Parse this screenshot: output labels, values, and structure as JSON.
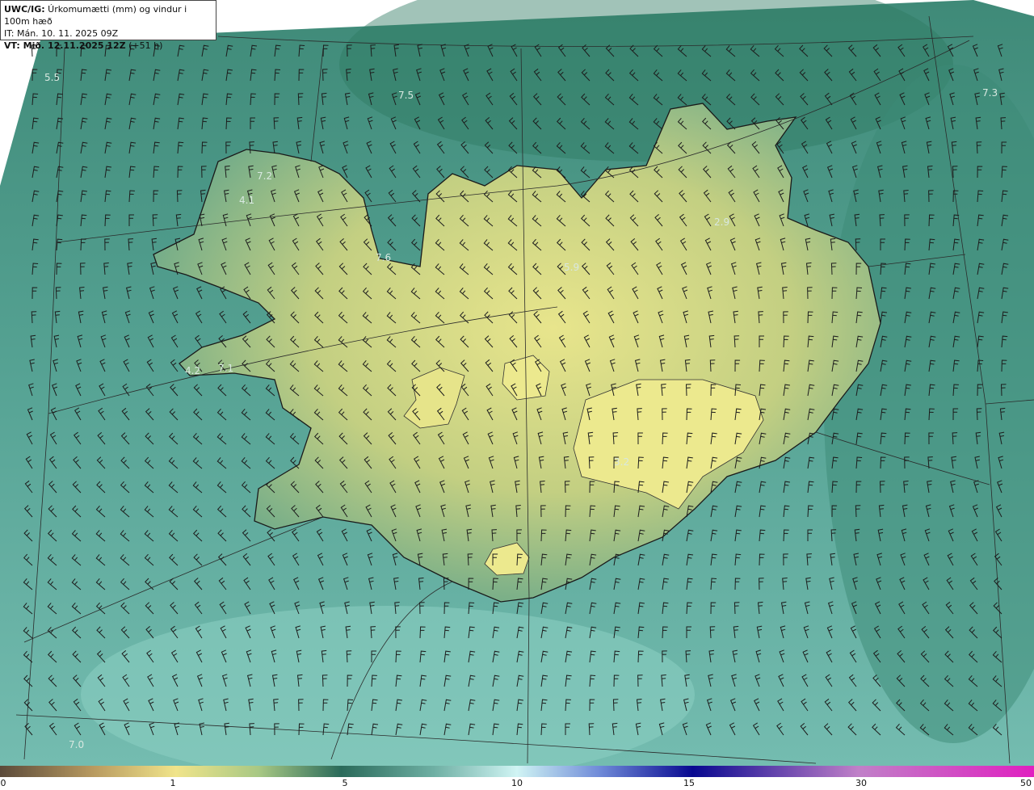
{
  "header": {
    "model": "UWC/IG:",
    "title": " Úrkomumætti (mm) og vindur i 100m hæð",
    "issue_time": "IT: Mán. 10. 11. 2025 09Z",
    "valid_prefix": "VT: ",
    "valid_time": "Mið. 12.11.2025 12Z",
    "lead": " (+51 h)"
  },
  "map": {
    "value_labels": [
      {
        "text": "5.5"
      },
      {
        "text": "7.5"
      },
      {
        "text": "7.3"
      },
      {
        "text": "7.2"
      },
      {
        "text": "4.1"
      },
      {
        "text": "2.9"
      },
      {
        "text": "7.6"
      },
      {
        "text": "5.9"
      },
      {
        "text": "4.2"
      },
      {
        "text": "7.1"
      },
      {
        "text": "3.2"
      },
      {
        "text": "7.0"
      }
    ]
  },
  "colorbar": {
    "ticks": [
      "0",
      "1",
      "5",
      "10",
      "15",
      "30",
      "50"
    ],
    "colors": [
      "#5b4a3a",
      "#b89a60",
      "#f0e48a",
      "#6fb08a",
      "#2a6a5a",
      "#9ad8cc",
      "#d0f4f4",
      "#3050c0",
      "#080890",
      "#c070c0",
      "#e020c0"
    ]
  },
  "colors": {
    "sea": "#4c9a88",
    "land_high": "#e6e48a",
    "coast": "#1a1a1a"
  }
}
